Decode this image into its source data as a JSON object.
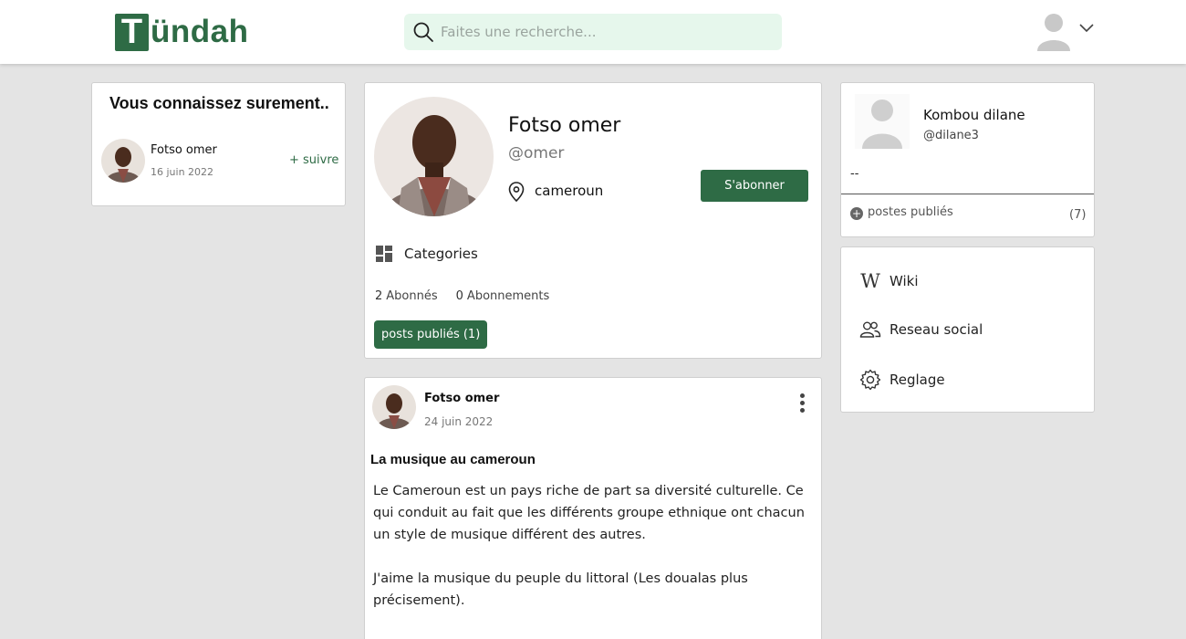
{
  "header": {
    "logo_letter": "T",
    "logo_text": "ündah",
    "search_placeholder": "Faites une recherche..."
  },
  "suggestions": {
    "title": "Vous connaissez surement..",
    "items": [
      {
        "name": "Fotso omer",
        "date": "16 juin 2022",
        "follow_label": "+ suivre"
      }
    ]
  },
  "profile": {
    "name": "Fotso omer",
    "handle": "@omer",
    "location": "cameroun",
    "subscribe_label": "S'abonner",
    "categories_label": "Categories",
    "followers_count": "2",
    "followers_label": "Abonnés",
    "following_count": "0",
    "following_label": "Abonnements",
    "posts_button_label": "posts publiés (1)"
  },
  "post": {
    "author": "Fotso omer",
    "date": "24 juin 2022",
    "title": "La musique au cameroun",
    "paragraphs": [
      "Le Cameroun est un pays riche de part sa diversité culturelle. Ce qui conduit au fait que les différents groupe ethnique ont chacun un style de musique différent des autres.",
      "J'aime la musique du peuple du littoral (Les doualas plus précisement)."
    ]
  },
  "current_user": {
    "name": "Kombou dilane",
    "handle": "@dilane3",
    "bio": "--",
    "posts_label": "postes publiés",
    "posts_count": "(7)"
  },
  "nav": {
    "items": [
      {
        "icon": "wiki-icon",
        "label": "Wiki"
      },
      {
        "icon": "people-icon",
        "label": "Reseau social"
      },
      {
        "icon": "gear-icon",
        "label": "Reglage"
      }
    ]
  },
  "colors": {
    "brand_green": "#2e6b45",
    "search_bg": "#e6f7ec",
    "page_bg": "#e4e4e4"
  }
}
